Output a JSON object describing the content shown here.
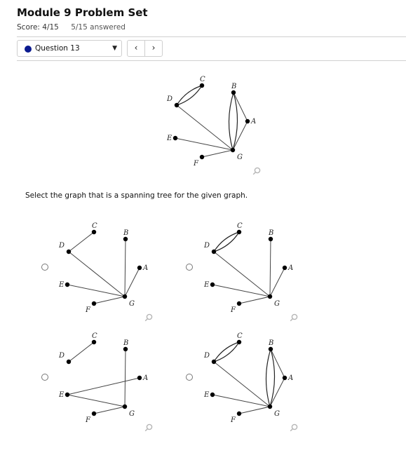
{
  "header": {
    "title": "Module 9 Problem Set",
    "score": "Score: 4/15",
    "answered": "5/15 answered"
  },
  "question_nav": {
    "selected": "Question 13",
    "caret": "▼",
    "prev": "‹",
    "next": "›",
    "status_color": "#0b1a8f"
  },
  "prompt": "Select the graph that is a spanning tree for the given graph.",
  "vertex_labels": {
    "A": "A",
    "B": "B",
    "C": "C",
    "D": "D",
    "E": "E",
    "F": "F",
    "G": "G"
  },
  "icons": {
    "zoom": "magnifier-icon"
  },
  "graphs": {
    "given": {
      "edges": [
        [
          "C",
          "D",
          2
        ],
        [
          "D",
          "G",
          1
        ],
        [
          "E",
          "G",
          1
        ],
        [
          "F",
          "G",
          1
        ],
        [
          "B",
          "G",
          2
        ],
        [
          "B",
          "A",
          1
        ],
        [
          "A",
          "G",
          1
        ]
      ]
    },
    "options": [
      {
        "edges": [
          [
            "C",
            "D",
            1
          ],
          [
            "D",
            "G",
            1
          ],
          [
            "E",
            "G",
            1
          ],
          [
            "F",
            "G",
            1
          ],
          [
            "B",
            "G",
            1
          ],
          [
            "A",
            "G",
            1
          ]
        ]
      },
      {
        "edges": [
          [
            "C",
            "D",
            2
          ],
          [
            "D",
            "G",
            1
          ],
          [
            "E",
            "G",
            1
          ],
          [
            "F",
            "G",
            1
          ],
          [
            "B",
            "G",
            1
          ],
          [
            "A",
            "G",
            1
          ]
        ]
      },
      {
        "edges": [
          [
            "C",
            "D",
            1
          ],
          [
            "B",
            "G",
            1
          ],
          [
            "E",
            "A",
            1
          ],
          [
            "E",
            "G",
            1
          ],
          [
            "F",
            "G",
            1
          ]
        ]
      },
      {
        "edges": [
          [
            "C",
            "D",
            2
          ],
          [
            "D",
            "G",
            1
          ],
          [
            "E",
            "G",
            1
          ],
          [
            "F",
            "G",
            1
          ],
          [
            "B",
            "G",
            2
          ],
          [
            "B",
            "A",
            1
          ],
          [
            "A",
            "G",
            1
          ]
        ]
      }
    ]
  }
}
